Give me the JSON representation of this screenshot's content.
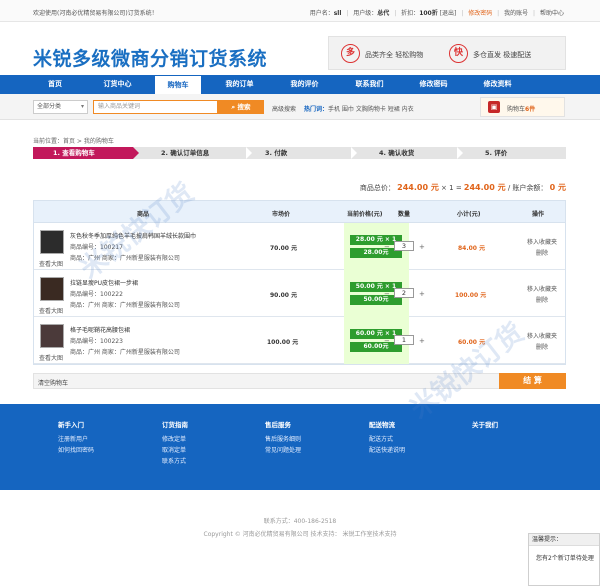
{
  "topbar": {
    "welcome": "欢迎使用(河南必优精贸易有限公司)订货系统！",
    "username_label": "用户名：",
    "username": "sll",
    "level_label": "用户级：",
    "level": "总代",
    "discount_label": "折扣：",
    "discount": "100折",
    "logout": "[退出]",
    "change_password": "修改密码",
    "my_account": "我的账号",
    "help": "帮助中心"
  },
  "brand": {
    "logo": "米锐多级微商分销订货系统",
    "promo": [
      {
        "badge": "多",
        "text": "品类齐全 轻松购物"
      },
      {
        "badge": "快",
        "text": "多仓直发 极速配送"
      }
    ]
  },
  "nav": {
    "items": [
      "首页",
      "订货中心",
      "购物车",
      "我的订单",
      "我的评价",
      "联系我们",
      "修改密码",
      "修改资料"
    ],
    "active_index": 2
  },
  "search": {
    "category": "全部分类",
    "placeholder": "输入商品关键词",
    "button": "搜索",
    "advanced": "高级搜索",
    "hot_label": "热门词：",
    "hot_words": "手机 围巾 文胸购物卡 短裙 内衣"
  },
  "cart": {
    "label": "购物车",
    "count": "6件"
  },
  "breadcrumb": "当前位置：首页 > 我的购物车",
  "steps": [
    "1. 查看购物车",
    "2. 确认订单信息",
    "3. 付款",
    "4. 确认收货",
    "5. 评价"
  ],
  "summary": {
    "total_label": "商品总价：",
    "total": "244.00 元",
    "times": "× 1 =",
    "total2": "244.00 元",
    "balance_label": "/ 账户余额：",
    "balance": "0 元"
  },
  "table": {
    "headers": [
      "商品",
      "市场价",
      "当前价格(元)",
      "数量",
      "小计(元)",
      "操作"
    ],
    "rows": [
      {
        "name": "灰色秋冬季加厚纯色羊毛披肩韩国羊绒长款围巾",
        "code": "商品编号：100217",
        "shop": "商品：广州  商家：广州新星服装有限公司",
        "view": "查看大图",
        "market": "70.00 元",
        "price_line": "28.00 元 × 1",
        "price": "28.00元",
        "qty": "3",
        "subtotal": "84.00 元",
        "op1": "移入收藏夹",
        "op2": "删除"
      },
      {
        "name": "拉链显瘦PU皮包裙一步裙",
        "code": "商品编号：100222",
        "shop": "商品：广州  商家：广州新星服装有限公司",
        "view": "查看大图",
        "market": "90.00 元",
        "price_line": "50.00 元 × 1",
        "price": "50.00元",
        "qty": "2",
        "subtotal": "100.00 元",
        "op1": "移入收藏夹",
        "op2": "删除"
      },
      {
        "name": "格子毛呢鞘花高腰包裙",
        "code": "商品编号：100223",
        "shop": "商品：广州  商家：广州新星服装有限公司",
        "view": "查看大图",
        "market": "100.00 元",
        "price_line": "60.00 元 × 1",
        "price": "60.00元",
        "qty": "1",
        "subtotal": "60.00 元",
        "op1": "移入收藏夹",
        "op2": "删除"
      }
    ],
    "clear_cart": "清空购物车",
    "checkout": "结 算"
  },
  "footer": {
    "columns": [
      {
        "title": "新手入门",
        "links": [
          "注册新用户",
          "如何找回密码"
        ]
      },
      {
        "title": "订货指南",
        "links": [
          "修改定单",
          "取消定单",
          "联系方式"
        ]
      },
      {
        "title": "售后服务",
        "links": [
          "售后服务细则",
          "常见问题处理"
        ]
      },
      {
        "title": "配送物流",
        "links": [
          "配送方式",
          "配送快递说明"
        ]
      },
      {
        "title": "关于我们",
        "links": []
      }
    ],
    "contact": "联系方式：400-186-2518",
    "copyright": "Copyright © 河南必优精贸易有限公司 技术支持：     米锐工作室技术支持"
  },
  "watermark": "米锐快订货",
  "tip": {
    "title": "温馨提示：",
    "body": "您有2个新订单待处理"
  },
  "colors": {
    "brand_blue": "#1565c0",
    "accent_orange": "#f08a24",
    "price_green": "#2e9d2e",
    "step_active": "#c2185b"
  }
}
